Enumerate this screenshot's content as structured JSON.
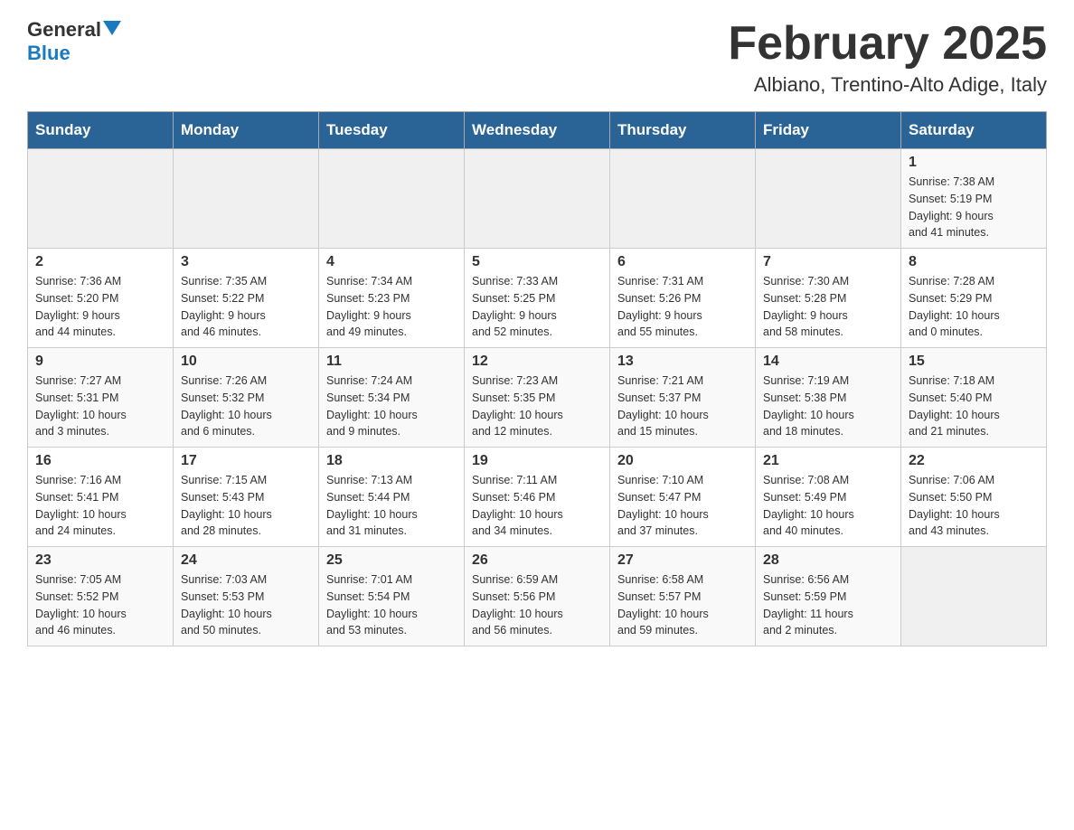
{
  "header": {
    "logo": {
      "general": "General",
      "blue": "Blue"
    },
    "title": "February 2025",
    "subtitle": "Albiano, Trentino-Alto Adige, Italy"
  },
  "days_of_week": [
    "Sunday",
    "Monday",
    "Tuesday",
    "Wednesday",
    "Thursday",
    "Friday",
    "Saturday"
  ],
  "weeks": [
    {
      "days": [
        {
          "num": "",
          "info": ""
        },
        {
          "num": "",
          "info": ""
        },
        {
          "num": "",
          "info": ""
        },
        {
          "num": "",
          "info": ""
        },
        {
          "num": "",
          "info": ""
        },
        {
          "num": "",
          "info": ""
        },
        {
          "num": "1",
          "info": "Sunrise: 7:38 AM\nSunset: 5:19 PM\nDaylight: 9 hours\nand 41 minutes."
        }
      ]
    },
    {
      "days": [
        {
          "num": "2",
          "info": "Sunrise: 7:36 AM\nSunset: 5:20 PM\nDaylight: 9 hours\nand 44 minutes."
        },
        {
          "num": "3",
          "info": "Sunrise: 7:35 AM\nSunset: 5:22 PM\nDaylight: 9 hours\nand 46 minutes."
        },
        {
          "num": "4",
          "info": "Sunrise: 7:34 AM\nSunset: 5:23 PM\nDaylight: 9 hours\nand 49 minutes."
        },
        {
          "num": "5",
          "info": "Sunrise: 7:33 AM\nSunset: 5:25 PM\nDaylight: 9 hours\nand 52 minutes."
        },
        {
          "num": "6",
          "info": "Sunrise: 7:31 AM\nSunset: 5:26 PM\nDaylight: 9 hours\nand 55 minutes."
        },
        {
          "num": "7",
          "info": "Sunrise: 7:30 AM\nSunset: 5:28 PM\nDaylight: 9 hours\nand 58 minutes."
        },
        {
          "num": "8",
          "info": "Sunrise: 7:28 AM\nSunset: 5:29 PM\nDaylight: 10 hours\nand 0 minutes."
        }
      ]
    },
    {
      "days": [
        {
          "num": "9",
          "info": "Sunrise: 7:27 AM\nSunset: 5:31 PM\nDaylight: 10 hours\nand 3 minutes."
        },
        {
          "num": "10",
          "info": "Sunrise: 7:26 AM\nSunset: 5:32 PM\nDaylight: 10 hours\nand 6 minutes."
        },
        {
          "num": "11",
          "info": "Sunrise: 7:24 AM\nSunset: 5:34 PM\nDaylight: 10 hours\nand 9 minutes."
        },
        {
          "num": "12",
          "info": "Sunrise: 7:23 AM\nSunset: 5:35 PM\nDaylight: 10 hours\nand 12 minutes."
        },
        {
          "num": "13",
          "info": "Sunrise: 7:21 AM\nSunset: 5:37 PM\nDaylight: 10 hours\nand 15 minutes."
        },
        {
          "num": "14",
          "info": "Sunrise: 7:19 AM\nSunset: 5:38 PM\nDaylight: 10 hours\nand 18 minutes."
        },
        {
          "num": "15",
          "info": "Sunrise: 7:18 AM\nSunset: 5:40 PM\nDaylight: 10 hours\nand 21 minutes."
        }
      ]
    },
    {
      "days": [
        {
          "num": "16",
          "info": "Sunrise: 7:16 AM\nSunset: 5:41 PM\nDaylight: 10 hours\nand 24 minutes."
        },
        {
          "num": "17",
          "info": "Sunrise: 7:15 AM\nSunset: 5:43 PM\nDaylight: 10 hours\nand 28 minutes."
        },
        {
          "num": "18",
          "info": "Sunrise: 7:13 AM\nSunset: 5:44 PM\nDaylight: 10 hours\nand 31 minutes."
        },
        {
          "num": "19",
          "info": "Sunrise: 7:11 AM\nSunset: 5:46 PM\nDaylight: 10 hours\nand 34 minutes."
        },
        {
          "num": "20",
          "info": "Sunrise: 7:10 AM\nSunset: 5:47 PM\nDaylight: 10 hours\nand 37 minutes."
        },
        {
          "num": "21",
          "info": "Sunrise: 7:08 AM\nSunset: 5:49 PM\nDaylight: 10 hours\nand 40 minutes."
        },
        {
          "num": "22",
          "info": "Sunrise: 7:06 AM\nSunset: 5:50 PM\nDaylight: 10 hours\nand 43 minutes."
        }
      ]
    },
    {
      "days": [
        {
          "num": "23",
          "info": "Sunrise: 7:05 AM\nSunset: 5:52 PM\nDaylight: 10 hours\nand 46 minutes."
        },
        {
          "num": "24",
          "info": "Sunrise: 7:03 AM\nSunset: 5:53 PM\nDaylight: 10 hours\nand 50 minutes."
        },
        {
          "num": "25",
          "info": "Sunrise: 7:01 AM\nSunset: 5:54 PM\nDaylight: 10 hours\nand 53 minutes."
        },
        {
          "num": "26",
          "info": "Sunrise: 6:59 AM\nSunset: 5:56 PM\nDaylight: 10 hours\nand 56 minutes."
        },
        {
          "num": "27",
          "info": "Sunrise: 6:58 AM\nSunset: 5:57 PM\nDaylight: 10 hours\nand 59 minutes."
        },
        {
          "num": "28",
          "info": "Sunrise: 6:56 AM\nSunset: 5:59 PM\nDaylight: 11 hours\nand 2 minutes."
        },
        {
          "num": "",
          "info": ""
        }
      ]
    }
  ]
}
